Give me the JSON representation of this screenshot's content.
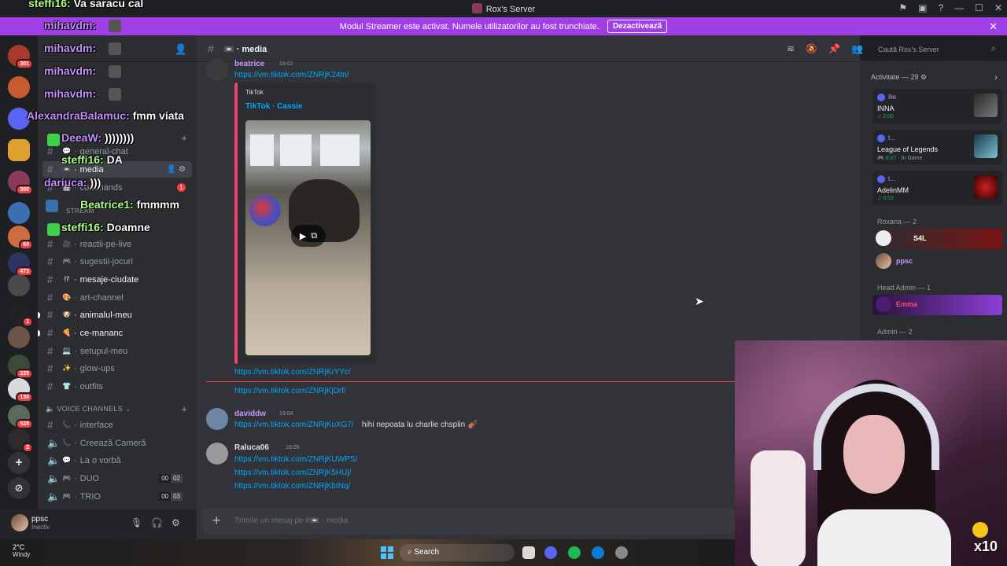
{
  "window": {
    "title": "Rox's Server"
  },
  "banner": {
    "text": "Modul Streamer este activat. Numele utilizatorilor au fost trunchiate.",
    "button": "Dezactivează",
    "color": "#a13fe6"
  },
  "rail_badges": [
    "301",
    "300",
    "60",
    "473",
    "1",
    "225",
    "130",
    "528",
    "2"
  ],
  "sidebar": {
    "channels": [
      {
        "emoji": "💬",
        "label": "general-chat",
        "state": "normal"
      },
      {
        "emoji": "📼",
        "label": "media",
        "state": "active"
      },
      {
        "emoji": "🤖",
        "label": "commands",
        "state": "normal",
        "badge": "1"
      },
      {
        "emoji": "🎥",
        "label": "reactii-pe-live",
        "state": "normal"
      },
      {
        "emoji": "🎮",
        "label": "sugestii-jocuri",
        "state": "normal"
      },
      {
        "emoji": "⁉",
        "label": "mesaje-ciudate",
        "state": "bold"
      },
      {
        "emoji": "🎨",
        "label": "art-channel",
        "state": "normal"
      },
      {
        "emoji": "🐶",
        "label": "animalul-meu",
        "state": "bold"
      },
      {
        "emoji": "🍕",
        "label": "ce-mananc",
        "state": "bold"
      },
      {
        "emoji": "💻",
        "label": "setupul-meu",
        "state": "normal"
      },
      {
        "emoji": "✨",
        "label": "glow-ups",
        "state": "normal"
      },
      {
        "emoji": "👕",
        "label": "outfits",
        "state": "normal"
      }
    ],
    "stream_category": "STREAM",
    "voice_header": "VOICE CHANNELS",
    "voice_channels": [
      {
        "emoji": "📞",
        "label": "interface"
      },
      {
        "emoji": "📞",
        "label": "Creează Cameră"
      },
      {
        "emoji": "💬",
        "label": "La o vorbă"
      },
      {
        "emoji": "🎮",
        "label": "DUO",
        "count": "00",
        "limit": "02"
      },
      {
        "emoji": "🎮",
        "label": "TRIO",
        "count": "00",
        "limit": "03"
      }
    ]
  },
  "user": {
    "name": "ppsc",
    "status": "Inactiv"
  },
  "chat": {
    "channel": "media",
    "search_placeholder": "Caută Rox's Server",
    "messages": [
      {
        "author": "beatrice",
        "time": "19:02",
        "link": "https://vm.tiktok.com/ZNRjK24tn/"
      },
      {
        "link": "https://vm.tiktok.com/ZNRjKrYYc/"
      },
      {
        "link": "https://vm.tiktok.com/ZNRjKjDrf/"
      },
      {
        "author": "daviddw",
        "time": "19:04",
        "link": "https://vm.tiktok.com/ZNRjKuXG7/",
        "text": "hihi nepoata lu charlie chsplin 🎻"
      },
      {
        "author": "Raluca06",
        "time": "19:05",
        "link": "https://vm.tiktok.com/ZNRjKUWPS/"
      },
      {
        "link": "https://vm.tiktok.com/ZNRjK5HUj/"
      },
      {
        "link": "https://vm.tiktok.com/ZNRjKbtNq/"
      }
    ],
    "embed": {
      "provider": "TikTok",
      "title": "TikTok · Cassie"
    },
    "composer_placeholder": "Trimite un mesaj pe #📼 · media"
  },
  "members": {
    "activity_title": "Activitate — 29",
    "activities": [
      {
        "name": "Ilie",
        "game": "INNA",
        "time": "2:00"
      },
      {
        "name": "t...",
        "game": "League of Legends",
        "time": "8:07",
        "extra": "In Game"
      },
      {
        "name": "t...",
        "game": "AdelinMM",
        "time": "0:53"
      }
    ],
    "roles": [
      {
        "title": "Roxana — 2",
        "members": [
          "S4L",
          "ppsc"
        ]
      },
      {
        "title": "Head Admin — 1",
        "members": [
          "Emma"
        ]
      },
      {
        "title": "Admin — 2",
        "members": []
      }
    ]
  },
  "overlay_chat": [
    {
      "user": "steffi16:",
      "msg": "Va saracu cal"
    },
    {
      "user": "mihavdm:",
      "msg": ""
    },
    {
      "user": "mihavdm:",
      "msg": ""
    },
    {
      "user": "mihavdm:",
      "msg": ""
    },
    {
      "user": "mihavdm:",
      "msg": ""
    },
    {
      "user": "AlexandraBalamuc:",
      "msg": "fmm viata"
    },
    {
      "user": "DeeaW:",
      "msg": "))))))))"
    },
    {
      "user": "steffi16:",
      "msg": "DA"
    },
    {
      "user": "dariuca:",
      "msg": ")))"
    },
    {
      "user": "Beatrice1:",
      "msg": "fmmmm"
    },
    {
      "user": "steffi16:",
      "msg": "Doamne"
    }
  ],
  "webcam": {
    "multiplier": "x10"
  },
  "taskbar": {
    "temp": "2°C",
    "weather": "Windy",
    "search": "Search"
  }
}
